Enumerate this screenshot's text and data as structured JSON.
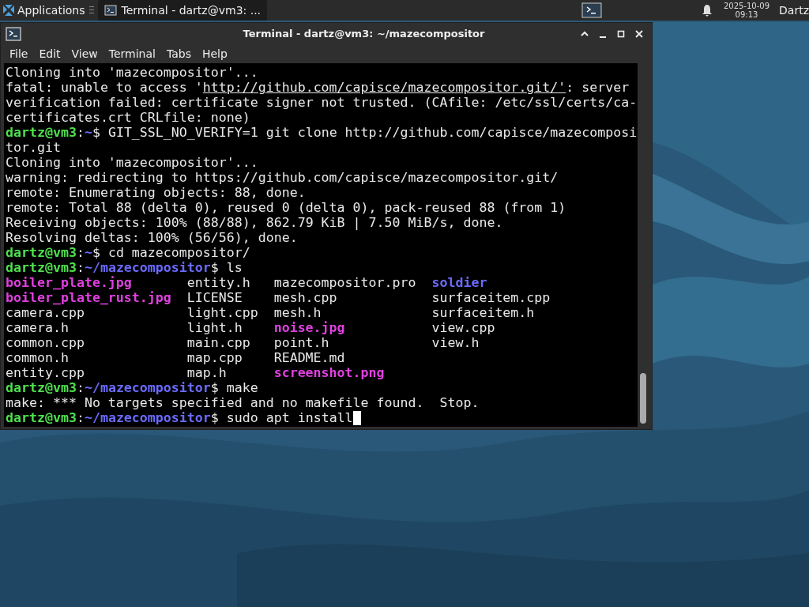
{
  "panel": {
    "menu_label": "Applications",
    "tasks": [
      {
        "label": "Terminal - dartz@vm3: ...",
        "selected": true
      }
    ],
    "clock": {
      "date": "2025-10-09",
      "time": "09:13"
    },
    "user": "Dartz"
  },
  "window": {
    "title": "Terminal - dartz@vm3: ~/mazecompositor",
    "menu": [
      "File",
      "Edit",
      "View",
      "Terminal",
      "Tabs",
      "Help"
    ],
    "lines": [
      {
        "kind": "text",
        "segments": [
          {
            "kind": "plain",
            "text": "Cloning into 'mazecompositor'..."
          }
        ]
      },
      {
        "kind": "text",
        "segments": [
          {
            "kind": "plain",
            "text": "fatal: unable to access '"
          },
          {
            "kind": "link",
            "text": "http://github.com/capisce/mazecompositor.git/'"
          },
          {
            "kind": "plain",
            "text": ": server"
          }
        ]
      },
      {
        "kind": "text",
        "segments": [
          {
            "kind": "plain",
            "text": "verification failed: certificate signer not trusted. (CAfile: /etc/ssl/certs/ca-"
          }
        ]
      },
      {
        "kind": "text",
        "segments": [
          {
            "kind": "plain",
            "text": "certificates.crt CRLfile: none)"
          }
        ]
      },
      {
        "kind": "text",
        "segments": [
          {
            "kind": "user",
            "text": "dartz@vm3"
          },
          {
            "kind": "plain",
            "text": ":"
          },
          {
            "kind": "path",
            "text": "~"
          },
          {
            "kind": "plain",
            "text": "$ GIT_SSL_NO_VERIFY=1 git clone http://github.com/capisce/mazecomposi"
          }
        ]
      },
      {
        "kind": "text",
        "segments": [
          {
            "kind": "plain",
            "text": "tor.git"
          }
        ]
      },
      {
        "kind": "text",
        "segments": [
          {
            "kind": "plain",
            "text": "Cloning into 'mazecompositor'..."
          }
        ]
      },
      {
        "kind": "text",
        "segments": [
          {
            "kind": "plain",
            "text": "warning: redirecting to https://github.com/capisce/mazecompositor.git/"
          }
        ]
      },
      {
        "kind": "text",
        "segments": [
          {
            "kind": "plain",
            "text": "remote: Enumerating objects: 88, done."
          }
        ]
      },
      {
        "kind": "text",
        "segments": [
          {
            "kind": "plain",
            "text": "remote: Total 88 (delta 0), reused 0 (delta 0), pack-reused 88 (from 1)"
          }
        ]
      },
      {
        "kind": "text",
        "segments": [
          {
            "kind": "plain",
            "text": "Receiving objects: 100% (88/88), 862.79 KiB | 7.50 MiB/s, done."
          }
        ]
      },
      {
        "kind": "text",
        "segments": [
          {
            "kind": "plain",
            "text": "Resolving deltas: 100% (56/56), done."
          }
        ]
      },
      {
        "kind": "text",
        "segments": [
          {
            "kind": "user",
            "text": "dartz@vm3"
          },
          {
            "kind": "plain",
            "text": ":"
          },
          {
            "kind": "path",
            "text": "~"
          },
          {
            "kind": "plain",
            "text": "$ cd mazecompositor/"
          }
        ]
      },
      {
        "kind": "text",
        "segments": [
          {
            "kind": "user",
            "text": "dartz@vm3"
          },
          {
            "kind": "plain",
            "text": ":"
          },
          {
            "kind": "path",
            "text": "~/mazecompositor"
          },
          {
            "kind": "plain",
            "text": "$ ls"
          }
        ]
      },
      {
        "kind": "columns",
        "cells": [
          {
            "text": "boiler_plate.jpg"
          },
          {
            "kind": "plain",
            "text": "entity.h"
          },
          {
            "kind": "plain",
            "text": "mazecompositor.pro"
          },
          {
            "kind": "dir",
            "text": "soldier"
          }
        ]
      },
      {
        "kind": "columns",
        "cells": [
          {
            "text": "boiler_plate_rust.jpg"
          },
          {
            "kind": "plain",
            "text": "LICENSE"
          },
          {
            "kind": "plain",
            "text": "mesh.cpp"
          },
          {
            "kind": "plain",
            "text": "surfaceitem.cpp"
          }
        ]
      },
      {
        "kind": "columns",
        "cells": [
          {
            "kind": "plain",
            "text": "camera.cpp"
          },
          {
            "kind": "plain",
            "text": "light.cpp"
          },
          {
            "kind": "plain",
            "text": "mesh.h"
          },
          {
            "kind": "plain",
            "text": "surfaceitem.h"
          }
        ]
      },
      {
        "kind": "columns",
        "cells": [
          {
            "kind": "plain",
            "text": "camera.h"
          },
          {
            "kind": "plain",
            "text": "light.h"
          },
          {
            "text": "noise.jpg"
          },
          {
            "kind": "plain",
            "text": "view.cpp"
          }
        ]
      },
      {
        "kind": "columns",
        "cells": [
          {
            "kind": "plain",
            "text": "common.cpp"
          },
          {
            "kind": "plain",
            "text": "main.cpp"
          },
          {
            "kind": "plain",
            "text": "point.h"
          },
          {
            "kind": "plain",
            "text": "view.h"
          }
        ]
      },
      {
        "kind": "columns",
        "cells": [
          {
            "kind": "plain",
            "text": "common.h"
          },
          {
            "kind": "plain",
            "text": "map.cpp"
          },
          {
            "kind": "plain",
            "text": "README.md"
          }
        ]
      },
      {
        "kind": "columns",
        "cells": [
          {
            "kind": "plain",
            "text": "entity.cpp"
          },
          {
            "kind": "plain",
            "text": "map.h"
          },
          {
            "text": "screenshot.png"
          }
        ]
      },
      {
        "kind": "text",
        "segments": [
          {
            "kind": "user",
            "text": "dartz@vm3"
          },
          {
            "kind": "plain",
            "text": ":"
          },
          {
            "kind": "path",
            "text": "~/mazecompositor"
          },
          {
            "kind": "plain",
            "text": "$ make"
          }
        ]
      },
      {
        "kind": "text",
        "segments": [
          {
            "kind": "plain",
            "text": "make: *** No targets specified and no makefile found.  Stop."
          }
        ]
      },
      {
        "kind": "text",
        "cursor": true,
        "segments": [
          {
            "kind": "user",
            "text": "dartz@vm3"
          },
          {
            "kind": "plain",
            "text": ":"
          },
          {
            "kind": "path",
            "text": "~/mazecompositor"
          },
          {
            "kind": "plain",
            "text": "$ sudo apt install"
          }
        ]
      }
    ]
  }
}
